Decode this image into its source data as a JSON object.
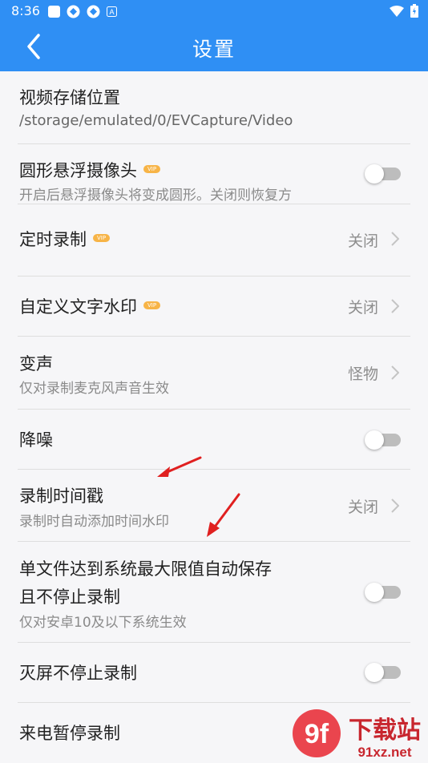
{
  "status": {
    "time": "8:36",
    "icons": [
      "square-icon",
      "sync-icon",
      "sync-icon",
      "a-icon"
    ],
    "right_icons": [
      "wifi-icon",
      "battery-icon"
    ]
  },
  "header": {
    "title": "设置"
  },
  "settings": {
    "video_path": {
      "label": "视频存储位置",
      "sub": "/storage/emulated/0/EVCapture/Video"
    },
    "float_camera": {
      "label": "圆形悬浮摄像头",
      "badge": "VIP",
      "sub": "开启后悬浮摄像头将变成圆形。关闭则恢复方",
      "enabled": false
    },
    "timer": {
      "label": "定时录制",
      "badge": "VIP",
      "value": "关闭"
    },
    "watermark": {
      "label": "自定义文字水印",
      "badge": "VIP",
      "value": "关闭"
    },
    "voice": {
      "label": "变声",
      "sub": "仅对录制麦克风声音生效",
      "value": "怪物"
    },
    "denoise": {
      "label": "降噪",
      "enabled": false
    },
    "timestamp": {
      "label": "录制时间戳",
      "sub": "录制时自动添加时间水印",
      "value": "关闭"
    },
    "autosave": {
      "label1": "单文件达到系统最大限值自动保存",
      "label2": "且不停止录制",
      "sub": "仅对安卓10及以下系统生效",
      "enabled": false
    },
    "screen_off": {
      "label": "灭屏不停止录制",
      "enabled": false
    },
    "call_pause": {
      "label": "来电暂停录制"
    }
  },
  "brand": {
    "logo_text": "下载站",
    "site": "91xz.net"
  },
  "colors": {
    "header": "#2f8ff4",
    "vip": "#f7b447",
    "annotation": "#e02020"
  }
}
